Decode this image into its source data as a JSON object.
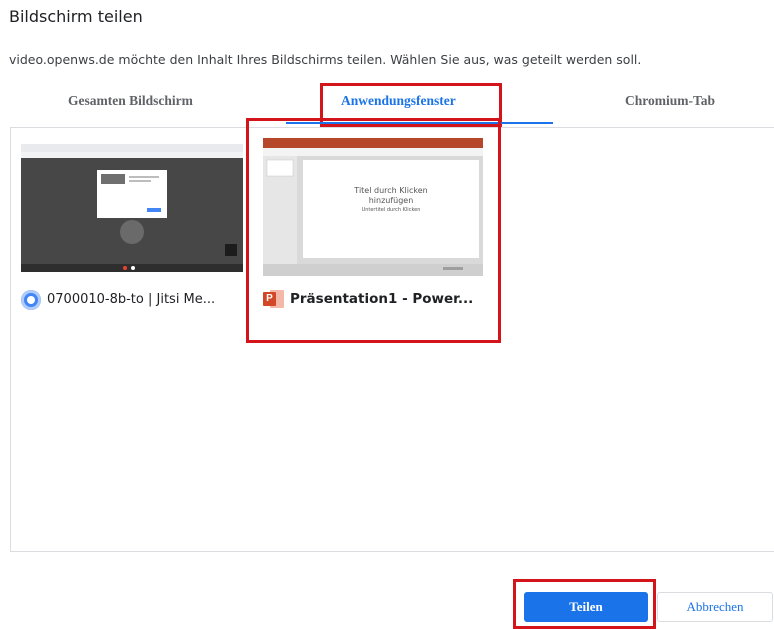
{
  "dialog": {
    "title": "Bildschirm teilen",
    "description": "video.openws.de möchte den Inhalt Ihres Bildschirms teilen. Wählen Sie aus, was geteilt werden soll."
  },
  "tabs": [
    {
      "label": "Gesamten Bildschirm",
      "active": false
    },
    {
      "label": "Anwendungsfenster",
      "active": true
    },
    {
      "label": "Chromium-Tab",
      "active": false
    }
  ],
  "sources": [
    {
      "label": "0700010-8b-to | Jitsi Me...",
      "icon": "chrome-icon",
      "selected": false
    },
    {
      "label": "Präsentation1 - Power...",
      "icon": "powerpoint-icon",
      "selected": true,
      "preview_text": [
        "Titel durch Klicken",
        "hinzufügen",
        "Untertitel durch Klicken"
      ]
    }
  ],
  "buttons": {
    "share_label": "Teilen",
    "cancel_label": "Abbrechen"
  },
  "colors": {
    "accent": "#1a73e8",
    "highlight": "#d3141a",
    "ppt_red": "#d24726"
  }
}
